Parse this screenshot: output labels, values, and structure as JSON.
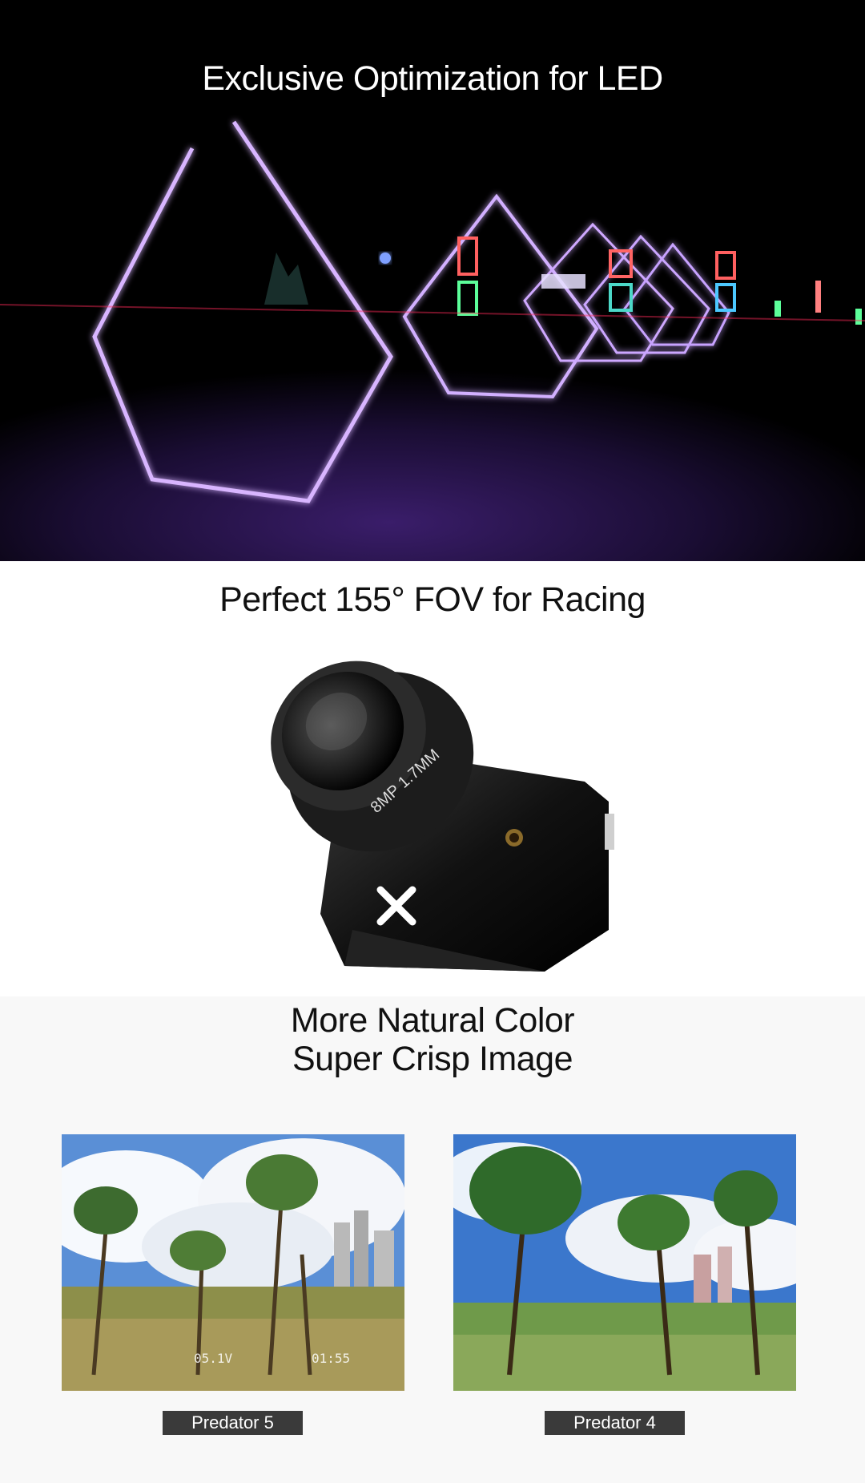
{
  "sections": {
    "led": {
      "title": "Exclusive Optimization for LED"
    },
    "fov": {
      "title": "Perfect 155° FOV for Racing",
      "lens_text": "8MP  1.7MM"
    },
    "color": {
      "title_line1": "More Natural Color",
      "title_line2": "Super Crisp Image",
      "comparisons": [
        {
          "caption": "Predator 5",
          "osd_voltage": "05.1V",
          "osd_time": "01:55"
        },
        {
          "caption": "Predator 4"
        }
      ]
    }
  },
  "colors": {
    "led_purple": "#b77cff",
    "caption_bg": "#3a3a3a",
    "sky_blue": "#3f7fd0"
  },
  "icons": [
    "foxeer-x-logo-icon"
  ]
}
